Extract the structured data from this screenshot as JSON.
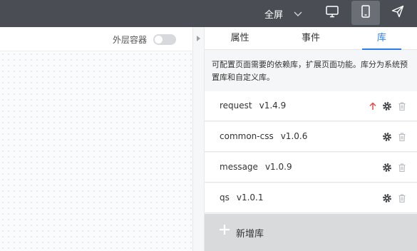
{
  "topbar": {
    "fullscreen_label": "全屏",
    "icons": [
      "chevron-down-icon",
      "desktop-icon",
      "mobile-icon",
      "send-icon"
    ]
  },
  "canvas": {
    "outer_container_label": "外层容器",
    "outer_container_enabled": false
  },
  "panel": {
    "tabs": [
      {
        "label": "属性",
        "active": false
      },
      {
        "label": "事件",
        "active": false
      },
      {
        "label": "库",
        "active": true
      }
    ],
    "description": "可配置页面需要的依赖库，扩展页面功能。库分为系统预置库和自定义库。",
    "libraries": [
      {
        "name": "request",
        "version": "v1.4.9",
        "has_update": true
      },
      {
        "name": "common-css",
        "version": "v1.0.6",
        "has_update": false
      },
      {
        "name": "message",
        "version": "v1.0.9",
        "has_update": false
      },
      {
        "name": "qs",
        "version": "v1.0.1",
        "has_update": false
      }
    ],
    "add_label": "新增库"
  },
  "colors": {
    "accent": "#2b7de9",
    "topbar": "#4a4e54",
    "update_arrow": "#e84a4a"
  }
}
